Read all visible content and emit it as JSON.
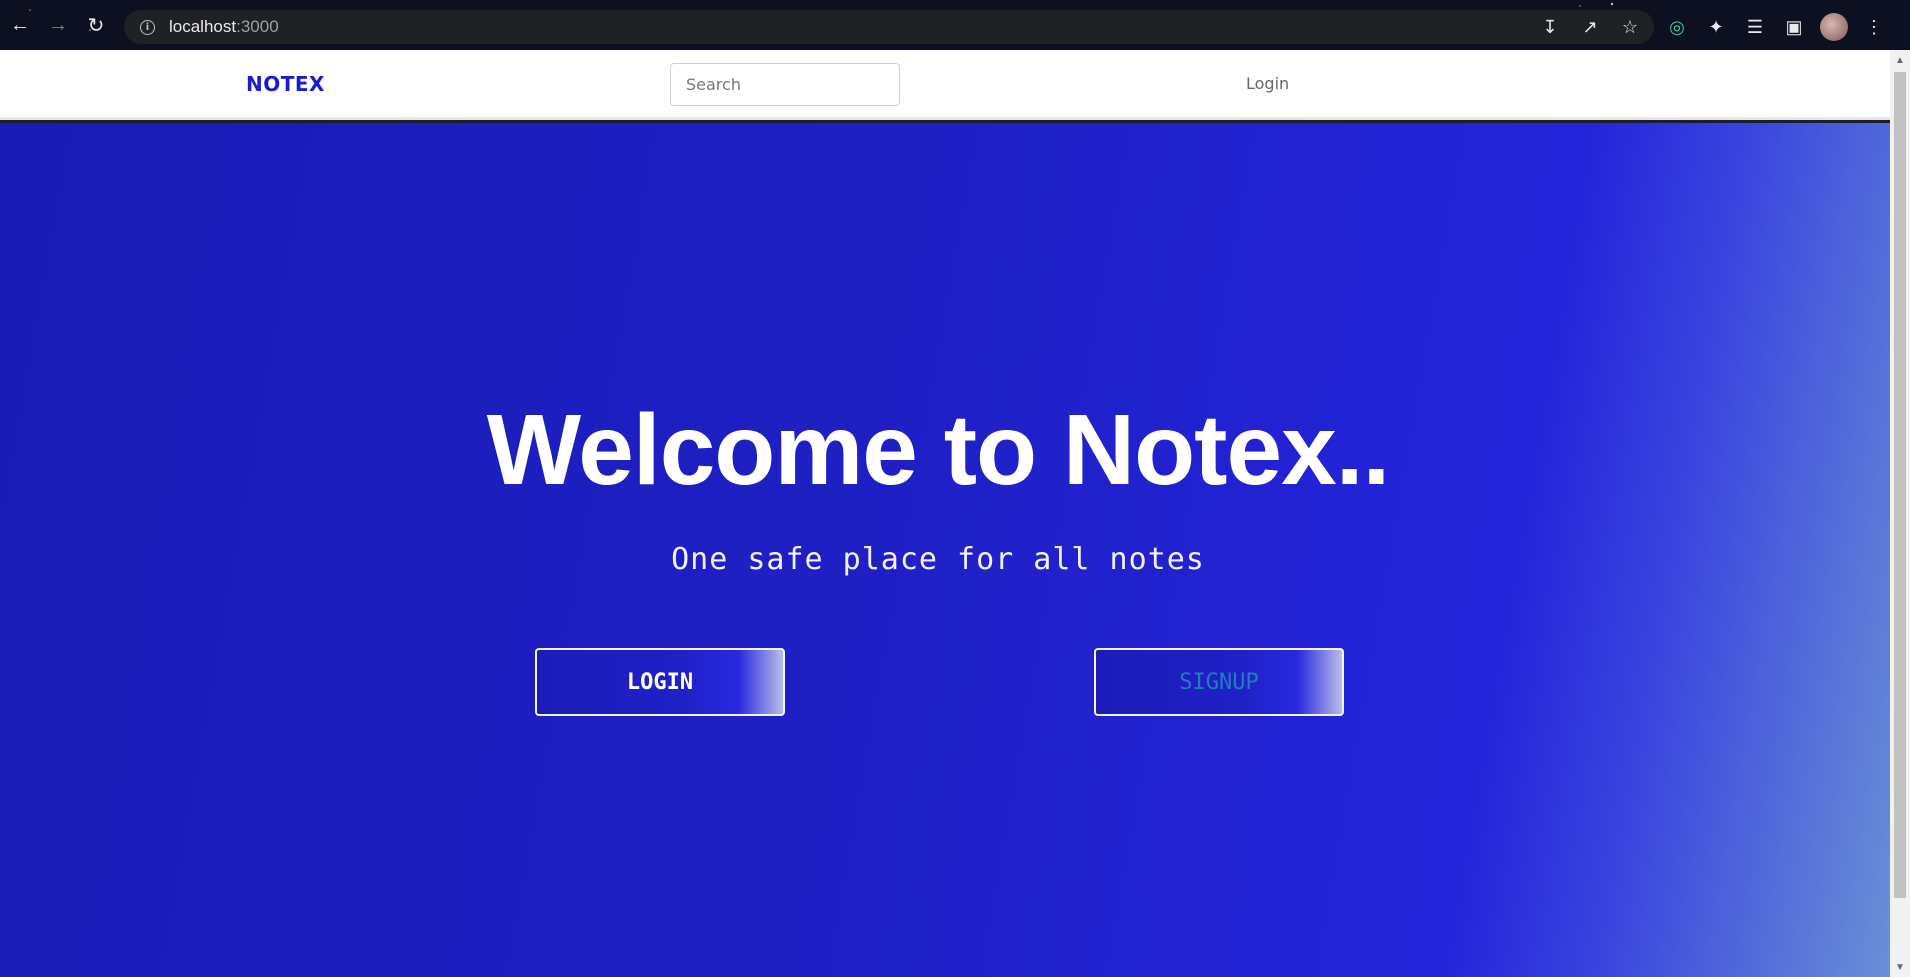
{
  "browser": {
    "url_host": "localhost",
    "url_port": ":3000",
    "icons": {
      "back": "back-arrow-icon",
      "forward": "forward-arrow-icon",
      "reload": "reload-icon",
      "info": "site-info-icon",
      "install": "install-app-icon",
      "share": "share-icon",
      "bookmark": "star-icon"
    }
  },
  "navbar": {
    "brand": "NOTEX",
    "search_placeholder": "Search",
    "login_link": "Login"
  },
  "hero": {
    "title": "Welcome to Notex..",
    "subtitle": "One safe place for all notes",
    "login_button": "LOGIN",
    "signup_button": "SIGNUP"
  },
  "colors": {
    "brand": "#1a19d9",
    "hero_start": "#1a1bb5",
    "hero_mid": "#2424db",
    "hero_end": "#6a8fd6",
    "signup_text": "#1f7fb9"
  }
}
